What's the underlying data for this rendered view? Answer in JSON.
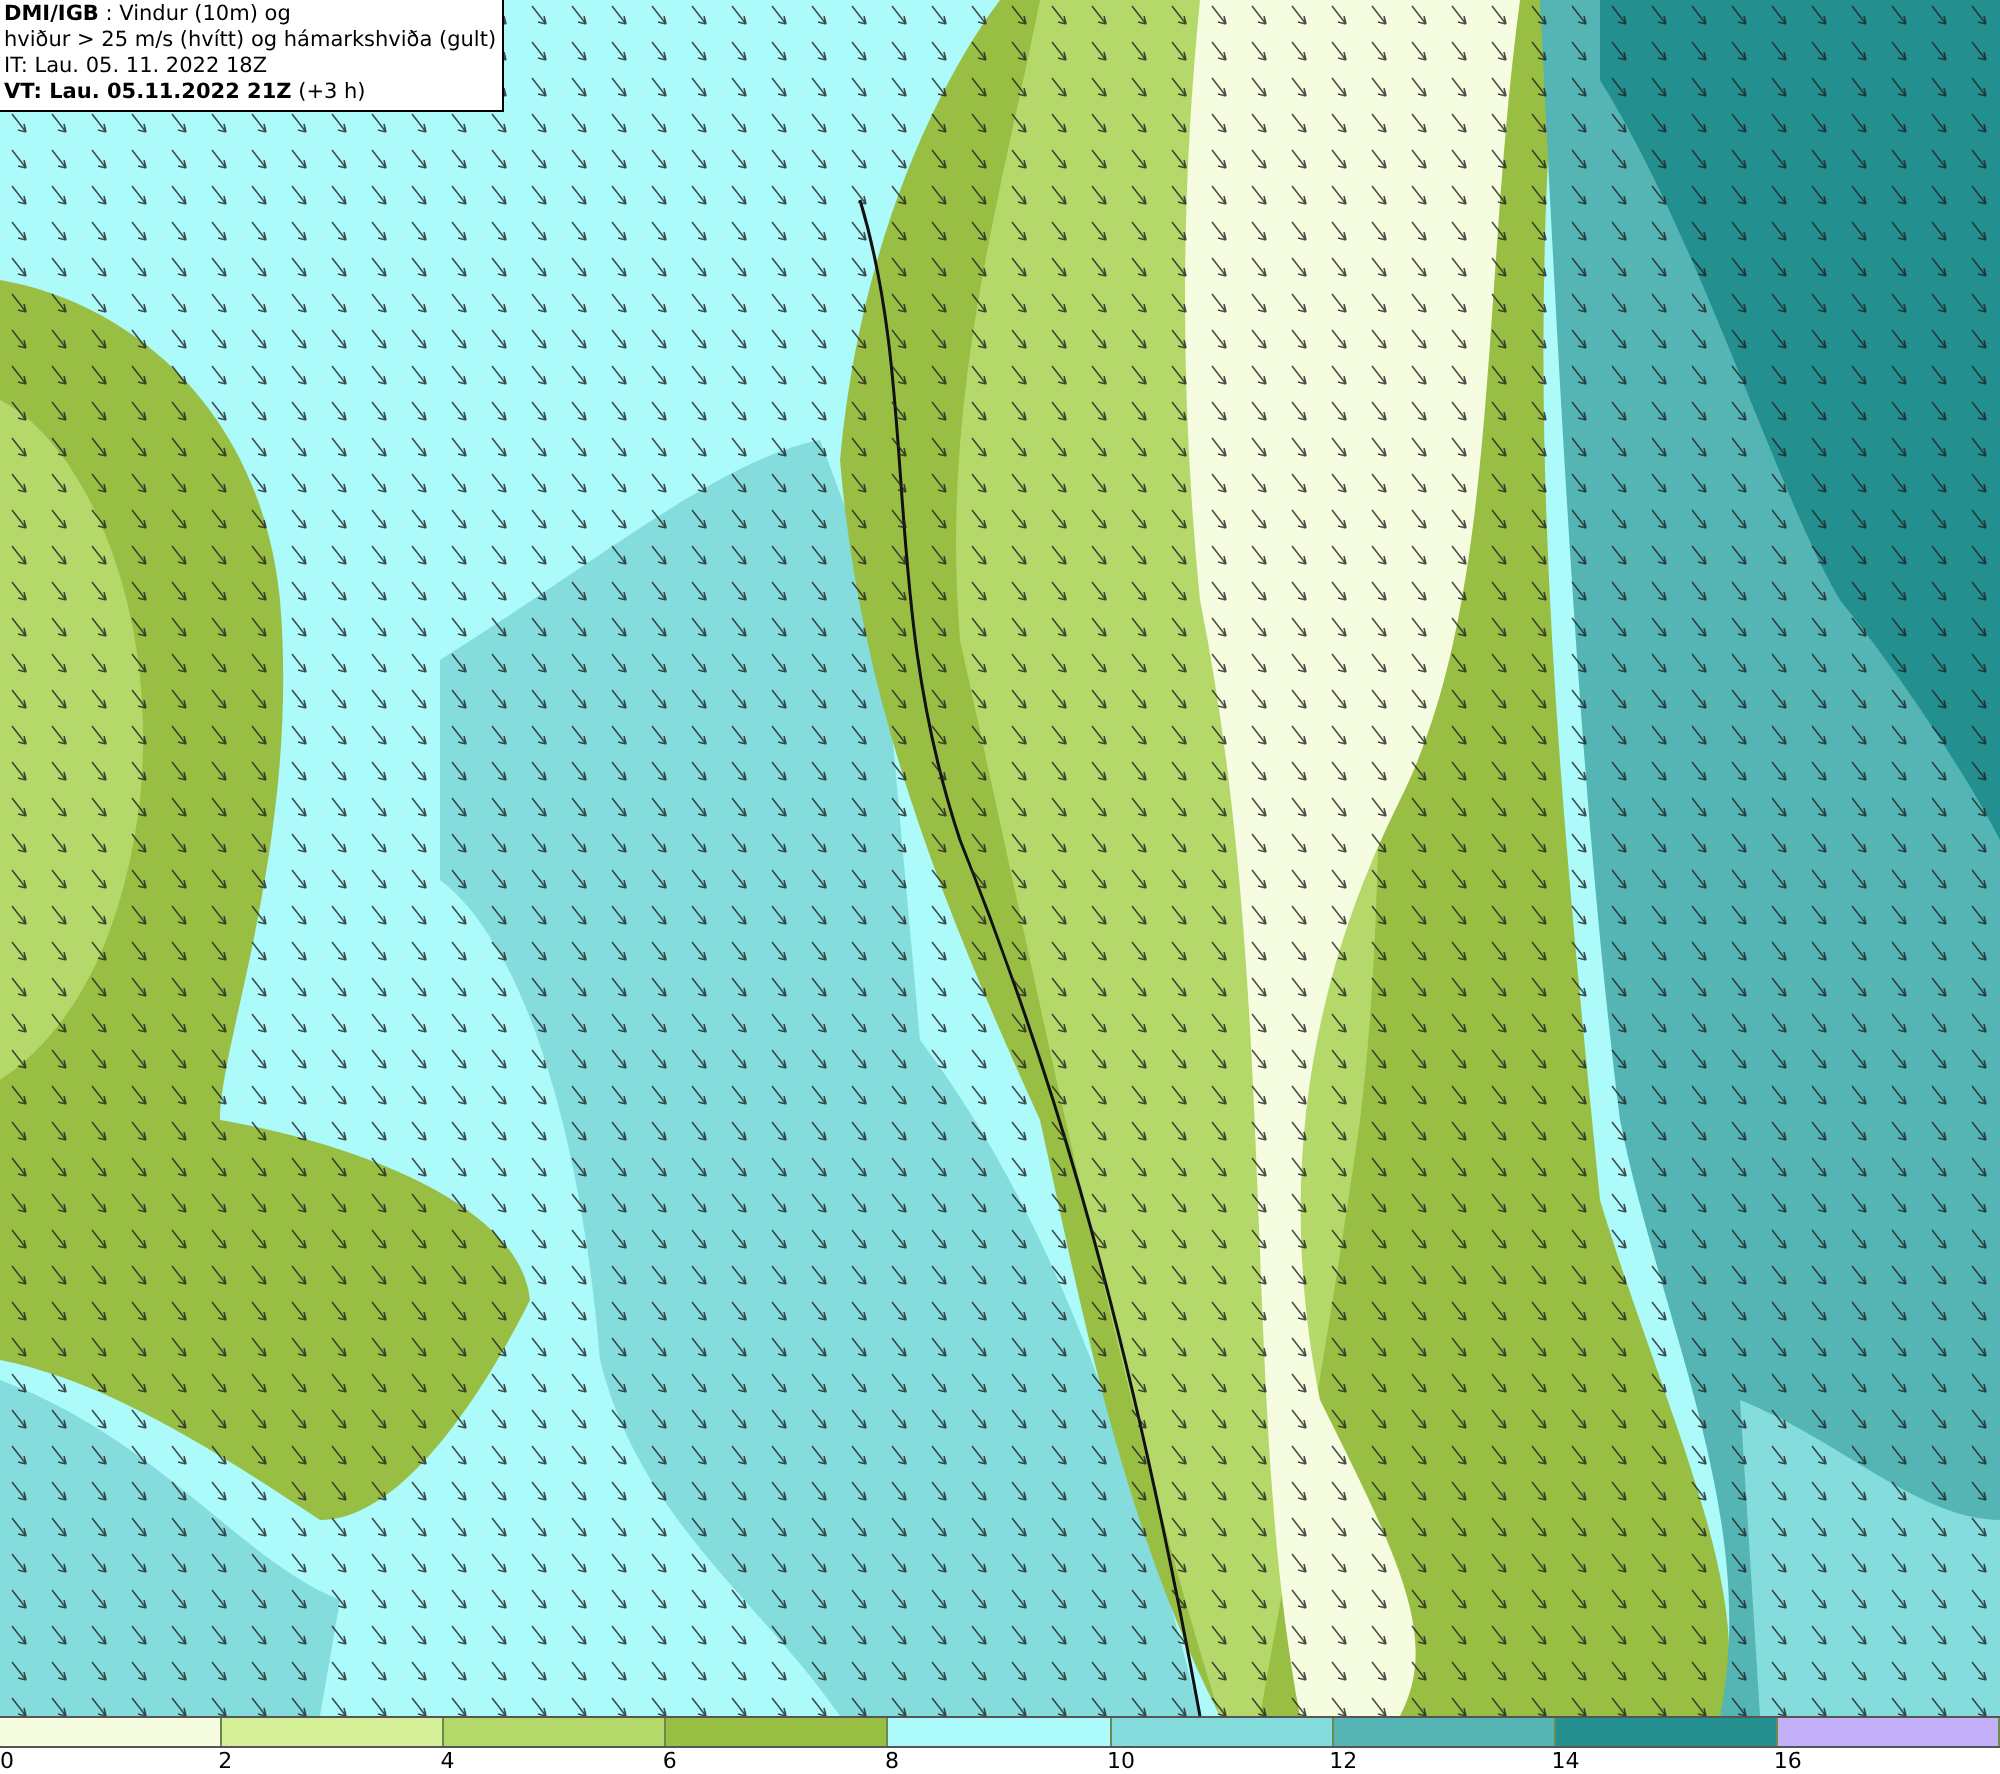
{
  "title_box": {
    "lines": [
      "**DMI/IGB** : Vindur (10m) og",
      "hviður > 25 m/s (hvítt) og hámarkshviða (gult)",
      "IT: Lau. 05. 11. 2022 18Z",
      "**VT: Lau. 05.11.2022 21Z** (+3 h)"
    ]
  },
  "legend": {
    "segments": [
      {
        "color": "#f5fce0"
      },
      {
        "color": "#d6f09a"
      },
      {
        "color": "#b5d86a"
      },
      {
        "color": "#98bf44"
      },
      {
        "color": "#acfafa"
      },
      {
        "color": "#84dcdc"
      },
      {
        "color": "#55b4b4"
      },
      {
        "color": "#238f8f"
      },
      {
        "color": "#c4b0f8"
      }
    ],
    "labels": [
      "0",
      "2",
      "4",
      "6",
      "8",
      "10",
      "12",
      "14",
      "16"
    ]
  }
}
